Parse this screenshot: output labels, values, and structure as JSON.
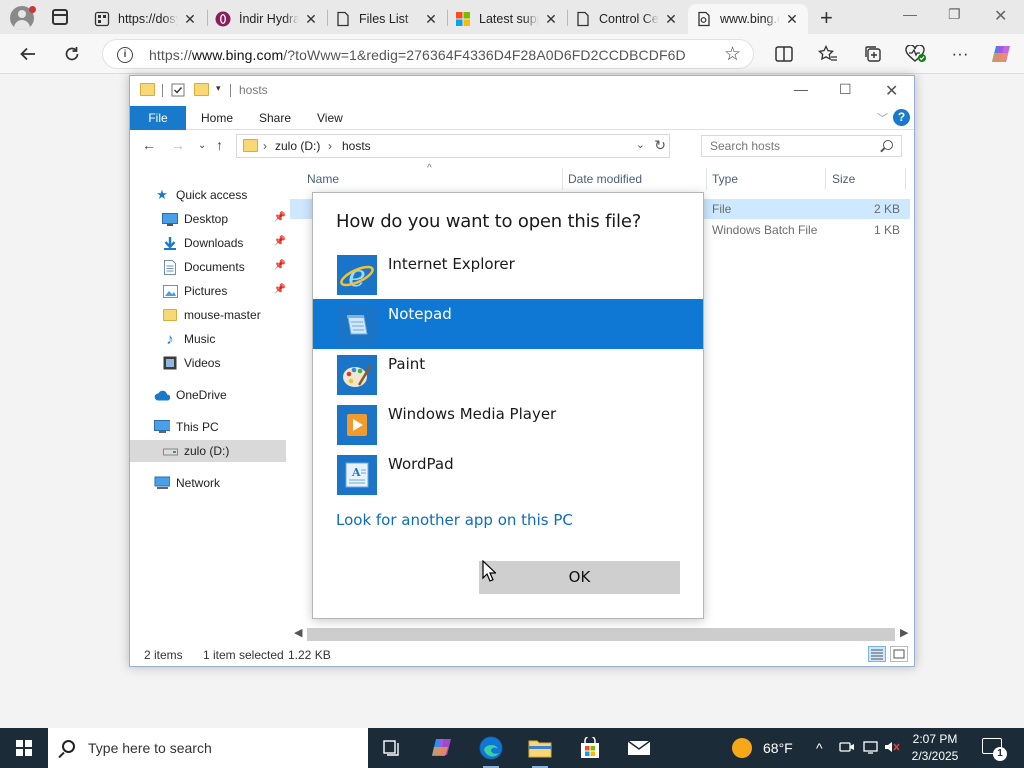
{
  "browser": {
    "tabs": [
      {
        "title": "https://dosyaupload.com",
        "icon": "web-page-icon"
      },
      {
        "title": "İndir Hydra",
        "icon": "opera-icon"
      },
      {
        "title": "Files List",
        "icon": "document-icon"
      },
      {
        "title": "Latest supported",
        "icon": "microsoft-icon"
      },
      {
        "title": "Control Center",
        "icon": "document-icon"
      },
      {
        "title": "www.bing.com",
        "icon": "bing-icon",
        "active": true
      }
    ],
    "address_prefix": "https://",
    "address_domain": "www.bing.com",
    "address_rest": "/?toWww=1&redig=276364F4336D4F28A0D6FD2CCDBCDF6D"
  },
  "explorer": {
    "title": "hosts",
    "ribbon": {
      "file": "File",
      "home": "Home",
      "share": "Share",
      "view": "View"
    },
    "breadcrumb": [
      "zulo (D:)",
      "hosts"
    ],
    "search_placeholder": "Search hosts",
    "nav": {
      "quick_access": "Quick access",
      "desktop": "Desktop",
      "downloads": "Downloads",
      "documents": "Documents",
      "pictures": "Pictures",
      "mouse_master": "mouse-master",
      "music": "Music",
      "videos": "Videos",
      "onedrive": "OneDrive",
      "this_pc": "This PC",
      "drive": "zulo (D:)",
      "network": "Network"
    },
    "columns": {
      "name": "Name",
      "date": "Date modified",
      "type": "Type",
      "size": "Size"
    },
    "rows": [
      {
        "type": "File",
        "size": "2 KB"
      },
      {
        "type": "Windows Batch File",
        "size": "1 KB"
      }
    ],
    "status": {
      "items": "2 items",
      "selected": "1 item selected",
      "size": "1.22 KB"
    }
  },
  "dialog": {
    "title": "How do you want to open this file?",
    "apps": [
      "Internet Explorer",
      "Notepad",
      "Paint",
      "Windows Media Player",
      "WordPad"
    ],
    "selected_app": "Notepad",
    "more_link": "Look for another app on this PC",
    "ok": "OK"
  },
  "taskbar": {
    "search_placeholder": "Type here to search",
    "weather": "68°F",
    "time": "2:07 PM",
    "date": "2/3/2025",
    "notification_count": "1"
  }
}
